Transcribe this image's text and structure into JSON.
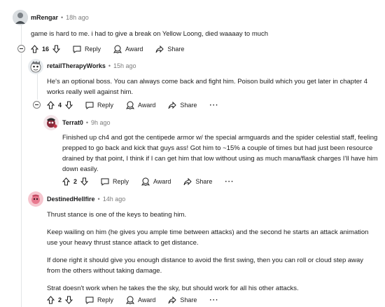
{
  "comments": [
    {
      "author": "mRengar",
      "time": "18h ago",
      "body": [
        "game is hard to me. i had to give a break on Yellow Loong, died waaaay to much"
      ],
      "votes": "16",
      "actions": {
        "reply": "Reply",
        "award": "Award",
        "share": "Share"
      }
    },
    {
      "author": "retailTherapyWorks",
      "time": "15h ago",
      "body": [
        "He's an optional boss. You can always come back and fight him. Poison build which you get later in chapter 4 works really well against him."
      ],
      "votes": "4",
      "actions": {
        "reply": "Reply",
        "award": "Award",
        "share": "Share",
        "more": "···"
      }
    },
    {
      "author": "Terrat0",
      "time": "9h ago",
      "body": [
        "Finished up ch4 and got the centipede armor w/ the special armguards and the spider celestial staff, feeling prepped to go back and kick that guys ass! Got him to ~15% a couple of times but had just been resource drained by that point, I think if I can get him that low without using as much mana/flask charges I'll have him down easily."
      ],
      "votes": "2",
      "actions": {
        "reply": "Reply",
        "award": "Award",
        "share": "Share",
        "more": "···"
      }
    },
    {
      "author": "DestinedHellfire",
      "time": "14h ago",
      "body": [
        "Thrust stance is one of the keys to beating him.",
        "Keep wailing on him (he gives you ample time between attacks) and the second he starts an attack animation use your heavy thrust stance attack to get distance.",
        "If done right it should give you enough distance to avoid the first swing, then you can roll or cloud step away from the others without taking damage.",
        "Strat doesn't work when he takes the the sky, but should work for all his other attacks."
      ],
      "votes": "2",
      "actions": {
        "reply": "Reply",
        "award": "Award",
        "share": "Share",
        "more": "···"
      }
    }
  ],
  "separator": "•",
  "colors": {
    "meta": "#7c7c7c",
    "text": "#1c1c1c",
    "line": "#e2e5e7"
  }
}
